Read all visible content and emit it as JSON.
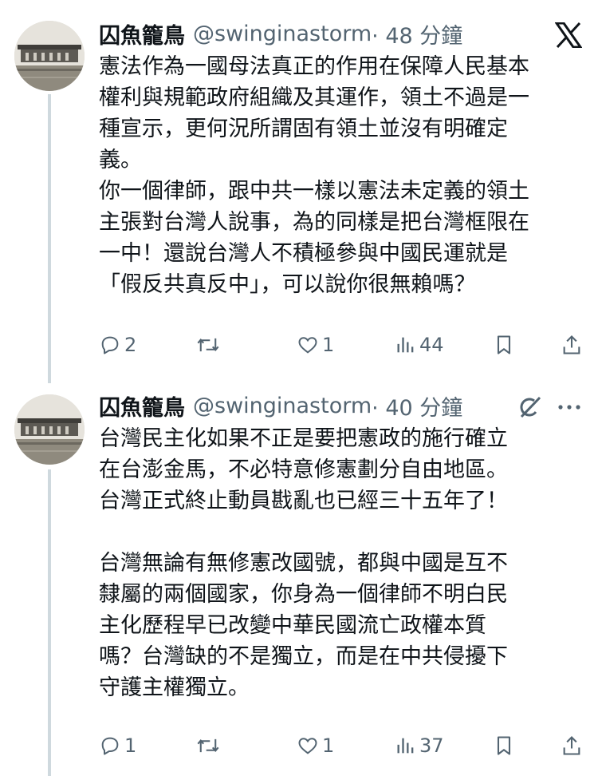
{
  "tweets": [
    {
      "author_name": "囚魚籠鳥",
      "handle": "@swinginastorm",
      "time": "· 48 分鐘",
      "body_lines": [
        "憲法作為一國母法真正的作用在保障人民基本",
        "權利與規範政府組織及其運作，領土不過是一",
        "種宣示，更何況所謂固有領土並沒有明確定",
        "義。",
        "你一個律師，跟中共一樣以憲法未定義的領土",
        "主張對台灣人說事，為的同樣是把台灣框限在",
        "一中！還說台灣人不積極參與中國民運就是",
        "「假反共真反中」，可以說你很無賴嗎？"
      ],
      "replies": "2",
      "retweets": "",
      "likes": "1",
      "views": "44",
      "top_icon": "x-logo-icon"
    },
    {
      "author_name": "囚魚籠鳥",
      "handle": "@swinginastorm",
      "time": "· 40 分鐘",
      "body_lines": [
        "台灣民主化如果不正是要把憲政的施行確立",
        "在台澎金馬，不必特意修憲劃分自由地區。",
        "台灣正式終止動員戡亂也已經三十五年了！",
        "",
        "台灣無論有無修憲改國號，都與中國是互不",
        "隸屬的兩個國家，你身為一個律師不明白民",
        "主化歷程早已改變中華民國流亡政權本質",
        "嗎？台灣缺的不是獨立，而是在中共侵擾下",
        "守護主權獨立。"
      ],
      "replies": "1",
      "retweets": "",
      "likes": "1",
      "views": "37",
      "top_icons": [
        "grok-icon",
        "more-icon"
      ]
    }
  ]
}
